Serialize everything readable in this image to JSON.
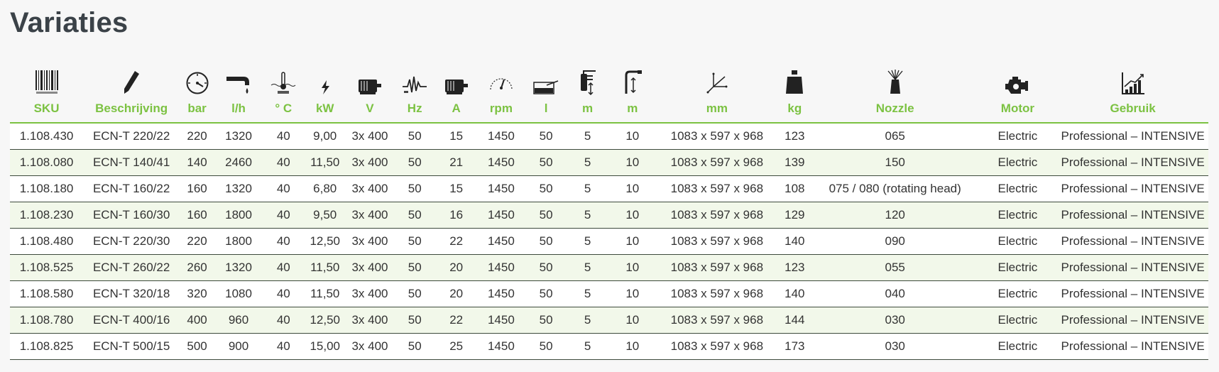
{
  "page": {
    "title": "Variaties"
  },
  "table": {
    "columns": [
      {
        "key": "sku",
        "label": "SKU",
        "icon": "barcode-icon"
      },
      {
        "key": "description",
        "label": "Beschrijving",
        "icon": "pencil-icon"
      },
      {
        "key": "pressure",
        "label": "bar",
        "icon": "pressure-gauge-icon"
      },
      {
        "key": "flow",
        "label": "l/h",
        "icon": "water-tap-icon"
      },
      {
        "key": "temperature",
        "label": "° C",
        "icon": "thermometer-input-icon"
      },
      {
        "key": "power",
        "label": "kW",
        "icon": "power-spark-icon"
      },
      {
        "key": "voltage",
        "label": "V",
        "icon": "motor-voltage-icon"
      },
      {
        "key": "frequency",
        "label": "Hz",
        "icon": "frequency-wave-icon"
      },
      {
        "key": "current",
        "label": "A",
        "icon": "motor-current-icon"
      },
      {
        "key": "speed",
        "label": "rpm",
        "icon": "speedometer-icon"
      },
      {
        "key": "tank",
        "label": "l",
        "icon": "tank-icon"
      },
      {
        "key": "cable",
        "label": "m",
        "icon": "power-plug-icon"
      },
      {
        "key": "hose",
        "label": "m",
        "icon": "hose-icon"
      },
      {
        "key": "dimensions",
        "label": "mm",
        "icon": "dimensions-axes-icon"
      },
      {
        "key": "weight",
        "label": "kg",
        "icon": "weight-icon"
      },
      {
        "key": "nozzle",
        "label": "Nozzle",
        "icon": "nozzle-spray-icon"
      },
      {
        "key": "motor",
        "label": "Motor",
        "icon": "engine-icon"
      },
      {
        "key": "usage",
        "label": "Gebruik",
        "icon": "usage-chart-icon"
      }
    ],
    "rows": [
      [
        "1.108.430",
        "ECN-T 220/22",
        "220",
        "1320",
        "40",
        "9,00",
        "3x 400",
        "50",
        "15",
        "1450",
        "50",
        "5",
        "10",
        "1083 x 597 x 968",
        "123",
        "065",
        "Electric",
        "Professional – INTENSIVE"
      ],
      [
        "1.108.080",
        "ECN-T 140/41",
        "140",
        "2460",
        "40",
        "11,50",
        "3x 400",
        "50",
        "21",
        "1450",
        "50",
        "5",
        "10",
        "1083 x 597 x 968",
        "139",
        "150",
        "Electric",
        "Professional – INTENSIVE"
      ],
      [
        "1.108.180",
        "ECN-T 160/22",
        "160",
        "1320",
        "40",
        "6,80",
        "3x 400",
        "50",
        "15",
        "1450",
        "50",
        "5",
        "10",
        "1083 x 597 x 968",
        "108",
        "075 / 080 (rotating head)",
        "Electric",
        "Professional – INTENSIVE"
      ],
      [
        "1.108.230",
        "ECN-T 160/30",
        "160",
        "1800",
        "40",
        "9,50",
        "3x 400",
        "50",
        "16",
        "1450",
        "50",
        "5",
        "10",
        "1083 x 597 x 968",
        "129",
        "120",
        "Electric",
        "Professional – INTENSIVE"
      ],
      [
        "1.108.480",
        "ECN-T 220/30",
        "220",
        "1800",
        "40",
        "12,50",
        "3x 400",
        "50",
        "22",
        "1450",
        "50",
        "5",
        "10",
        "1083 x 597 x 968",
        "140",
        "090",
        "Electric",
        "Professional – INTENSIVE"
      ],
      [
        "1.108.525",
        "ECN-T 260/22",
        "260",
        "1320",
        "40",
        "11,50",
        "3x 400",
        "50",
        "20",
        "1450",
        "50",
        "5",
        "10",
        "1083 x 597 x 968",
        "123",
        "055",
        "Electric",
        "Professional – INTENSIVE"
      ],
      [
        "1.108.580",
        "ECN-T 320/18",
        "320",
        "1080",
        "40",
        "11,50",
        "3x 400",
        "50",
        "20",
        "1450",
        "50",
        "5",
        "10",
        "1083 x 597 x 968",
        "140",
        "040",
        "Electric",
        "Professional – INTENSIVE"
      ],
      [
        "1.108.780",
        "ECN-T 400/16",
        "400",
        "960",
        "40",
        "12,50",
        "3x 400",
        "50",
        "22",
        "1450",
        "50",
        "5",
        "10",
        "1083 x 597 x 968",
        "144",
        "030",
        "Electric",
        "Professional – INTENSIVE"
      ],
      [
        "1.108.825",
        "ECN-T 500/15",
        "500",
        "900",
        "40",
        "15,00",
        "3x 400",
        "50",
        "25",
        "1450",
        "50",
        "5",
        "10",
        "1083 x 597 x 968",
        "173",
        "030",
        "Electric",
        "Professional – INTENSIVE"
      ]
    ]
  },
  "colors": {
    "accent": "#7cc242",
    "title": "#3b4248",
    "row_alt": "#f2f8ea",
    "row_line": "#3d4a3c"
  }
}
